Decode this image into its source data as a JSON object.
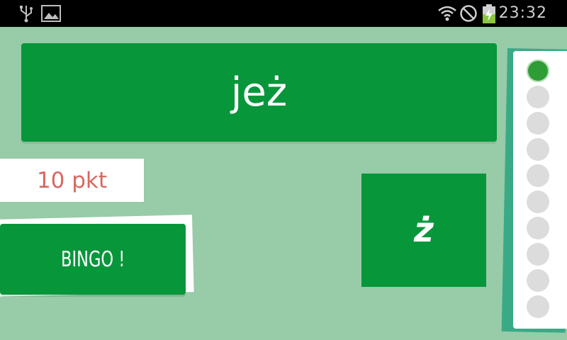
{
  "status_bar": {
    "time": "23:32",
    "icons": [
      "usb-icon",
      "image-icon",
      "wifi-icon",
      "no-sim-icon",
      "battery-charging-icon"
    ]
  },
  "game": {
    "word": "jeż",
    "score": "10 pkt",
    "bingo_label": "BINGO !",
    "letter": "ż"
  },
  "progress": {
    "total": 10,
    "completed": 1
  },
  "colors": {
    "background": "#98cba8",
    "card_green": "#08963b",
    "score_red": "#d9675f",
    "dot_inactive": "#dcdcdc",
    "dot_active": "#2e9d36"
  }
}
